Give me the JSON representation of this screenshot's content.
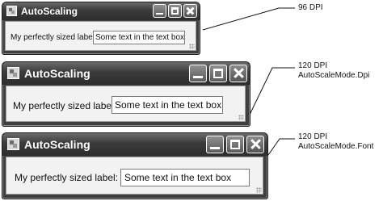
{
  "windows": [
    {
      "title": "AutoScaling",
      "label": "My perfectly sized label:",
      "textbox_value": "Some text in the text box"
    },
    {
      "title": "AutoScaling",
      "label": "My perfectly sized label:",
      "textbox_value": "Some text in the text box"
    },
    {
      "title": "AutoScaling",
      "label": "My perfectly sized label:",
      "textbox_value": "Some text in the text box"
    }
  ],
  "annotations": [
    {
      "line1": "96 DPI",
      "line2": ""
    },
    {
      "line1": "120 DPI",
      "line2": "AutoScaleMode.Dpi"
    },
    {
      "line1": "120 DPI",
      "line2": "AutoScaleMode.Font"
    }
  ],
  "icons": {
    "app": "app-icon",
    "minimize": "minimize-icon",
    "maximize": "maximize-icon",
    "close": "close-icon"
  }
}
